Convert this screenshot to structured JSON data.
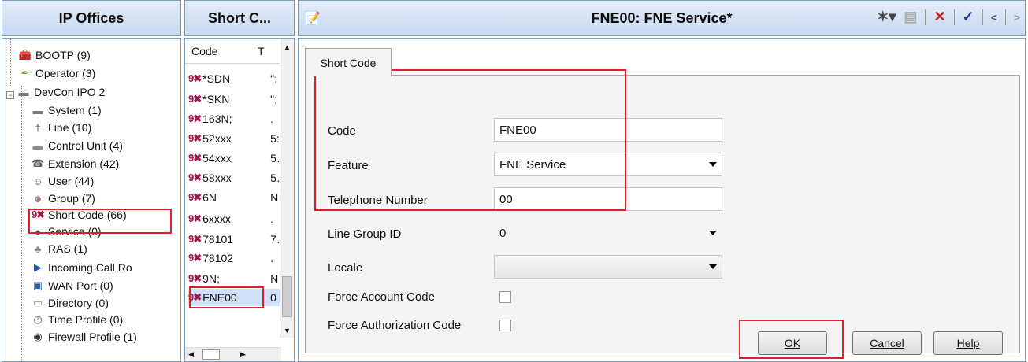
{
  "headers": {
    "ip_offices": "IP Offices",
    "short_codes": "Short C...",
    "main_title": "FNE00: FNE Service*"
  },
  "tree": {
    "items": [
      {
        "label": "BOOTP (9)",
        "icon": "bootp-icon"
      },
      {
        "label": "Operator (3)",
        "icon": "operator-icon"
      },
      {
        "label": "DevCon IPO 2",
        "icon": "system-device-icon"
      },
      {
        "label": "System (1)",
        "icon": "system-icon"
      },
      {
        "label": "Line (10)",
        "icon": "line-icon"
      },
      {
        "label": "Control Unit (4)",
        "icon": "control-unit-icon"
      },
      {
        "label": "Extension (42)",
        "icon": "extension-icon"
      },
      {
        "label": "User (44)",
        "icon": "user-icon"
      },
      {
        "label": "Group (7)",
        "icon": "group-icon"
      },
      {
        "label": "Short Code (66)",
        "icon": "short-code-icon"
      },
      {
        "label": "Service (0)",
        "icon": "service-icon"
      },
      {
        "label": "RAS (1)",
        "icon": "ras-icon"
      },
      {
        "label": "Incoming Call Ro",
        "icon": "incoming-call-icon"
      },
      {
        "label": "WAN Port (0)",
        "icon": "wan-port-icon"
      },
      {
        "label": "Directory (0)",
        "icon": "directory-icon"
      },
      {
        "label": "Time Profile (0)",
        "icon": "time-profile-icon"
      },
      {
        "label": "Firewall Profile (1)",
        "icon": "firewall-icon"
      }
    ]
  },
  "short_code_list": {
    "columns": [
      "Code",
      "T"
    ],
    "rows": [
      {
        "code": "*SDN",
        "tel": "\";"
      },
      {
        "code": "*SKN",
        "tel": "\";"
      },
      {
        "code": "163N;",
        "tel": "."
      },
      {
        "code": "52xxx",
        "tel": "5:"
      },
      {
        "code": "54xxx",
        "tel": "5…"
      },
      {
        "code": "58xxx",
        "tel": "5…"
      },
      {
        "code": "6N",
        "tel": "N"
      },
      {
        "code": "6xxxx",
        "tel": "."
      },
      {
        "code": "78101",
        "tel": "7…"
      },
      {
        "code": "78102",
        "tel": "."
      },
      {
        "code": "9N;",
        "tel": "N"
      },
      {
        "code": "FNE00",
        "tel": "0"
      }
    ]
  },
  "form": {
    "tab_label": "Short Code",
    "code_label": "Code",
    "code_value": "FNE00",
    "feature_label": "Feature",
    "feature_value": "FNE Service",
    "telephone_label": "Telephone Number",
    "telephone_value": "00",
    "line_group_label": "Line Group ID",
    "line_group_value": "0",
    "locale_label": "Locale",
    "locale_value": "",
    "force_account_label": "Force Account Code",
    "force_auth_label": "Force Authorization Code"
  },
  "buttons": {
    "ok": "OK",
    "cancel": "Cancel",
    "help": "Help"
  },
  "colors": {
    "highlight": "#e0202a",
    "short_code_icon": "#a0154a"
  }
}
